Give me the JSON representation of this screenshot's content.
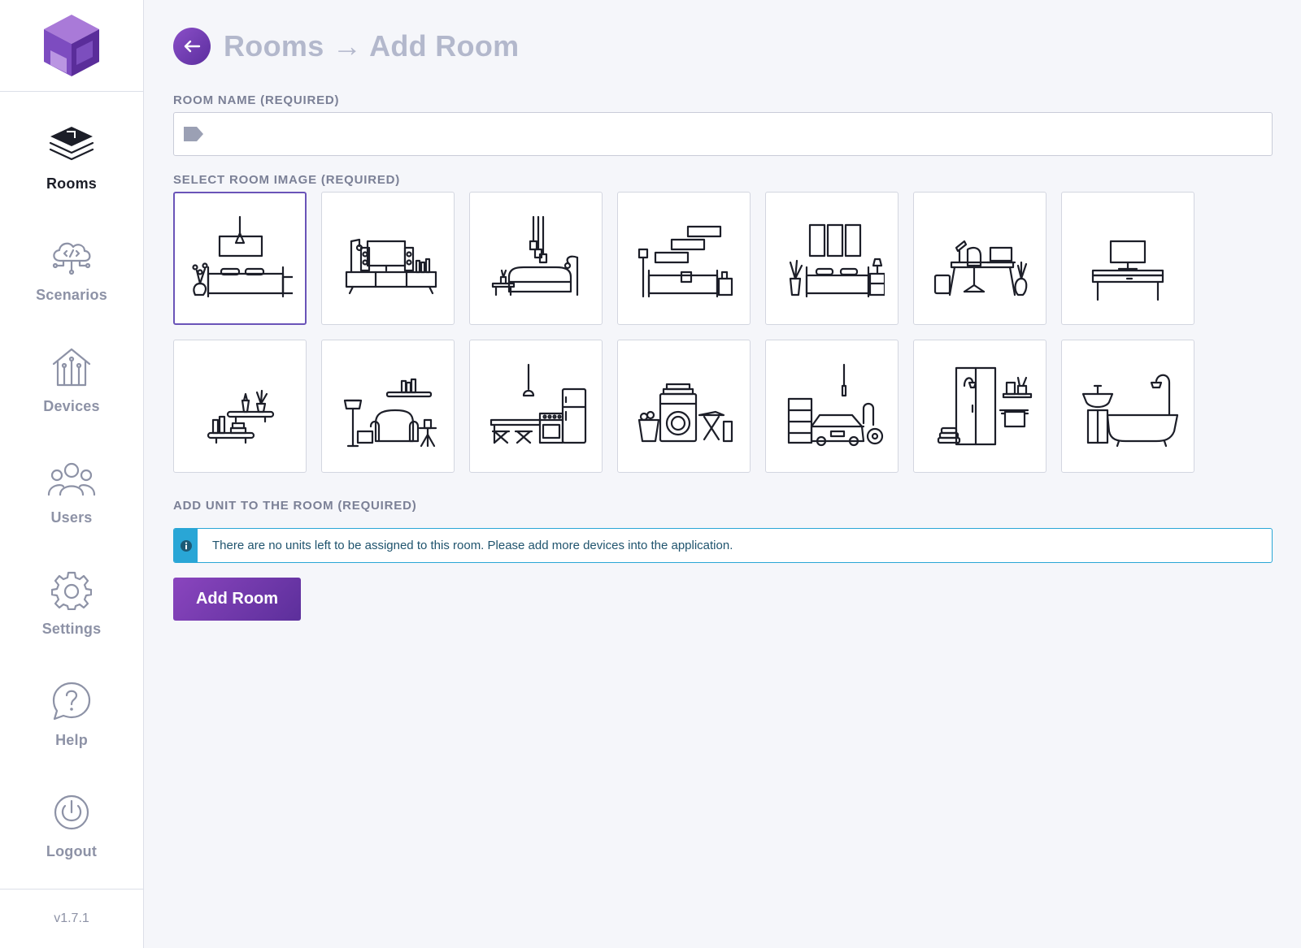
{
  "app": {
    "version": "v1.7.1",
    "brand_color": "#6a3fb0"
  },
  "sidebar": {
    "items": [
      {
        "label": "Rooms",
        "icon": "layers-icon",
        "active": true
      },
      {
        "label": "Scenarios",
        "icon": "cloud-code-icon",
        "active": false
      },
      {
        "label": "Devices",
        "icon": "house-circuit-icon",
        "active": false
      },
      {
        "label": "Users",
        "icon": "users-group-icon",
        "active": false
      },
      {
        "label": "Settings",
        "icon": "gear-icon",
        "active": false
      },
      {
        "label": "Help",
        "icon": "help-bubble-icon",
        "active": false
      },
      {
        "label": "Logout",
        "icon": "power-icon",
        "active": false
      }
    ]
  },
  "header": {
    "title": "Rooms → Add Room",
    "back_icon": "arrow-left-icon"
  },
  "form": {
    "room_name_label": "ROOM NAME (REQUIRED)",
    "room_name_value": "",
    "room_name_icon": "tag-icon",
    "image_label": "SELECT ROOM IMAGE (REQUIRED)",
    "images": [
      {
        "name": "bedroom-lamp",
        "selected": true
      },
      {
        "name": "tv-living-room",
        "selected": false
      },
      {
        "name": "sofa-pendant-lights",
        "selected": false
      },
      {
        "name": "sofa-shelves",
        "selected": false
      },
      {
        "name": "bedroom-frames",
        "selected": false
      },
      {
        "name": "office-desk-chair",
        "selected": false
      },
      {
        "name": "computer-desk",
        "selected": false
      },
      {
        "name": "wall-shelves",
        "selected": false
      },
      {
        "name": "armchair-reading",
        "selected": false
      },
      {
        "name": "kitchen",
        "selected": false
      },
      {
        "name": "laundry",
        "selected": false
      },
      {
        "name": "garage",
        "selected": false
      },
      {
        "name": "shower-room",
        "selected": false
      },
      {
        "name": "bathtub",
        "selected": false
      }
    ],
    "unit_label": "ADD UNIT TO THE ROOM (REQUIRED)",
    "unit_info_icon": "info-icon",
    "unit_info_message": "There are no units left to be assigned to this room. Please add more devices into the application.",
    "info_color": "#29a6d6",
    "submit_label": "Add Room"
  }
}
